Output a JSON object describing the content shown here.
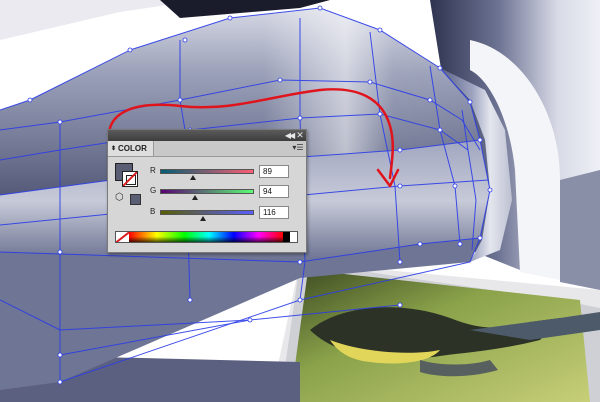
{
  "colors": {
    "fill": "#595e74",
    "accent_arrow": "#e0141c",
    "mesh": "#2b3de8",
    "panel_bg": "#d6d6d6",
    "titlebar": "#4a4a4a"
  },
  "icons": {
    "collapse": "double-chevron-left-icon",
    "close": "close-icon",
    "panel_menu": "panel-menu-icon",
    "tab_arrows": "updown-arrows-icon",
    "cube": "out-of-gamut-cube-icon"
  },
  "color_panel": {
    "collapse_glyph": "◀◀",
    "close_glyph": "✕",
    "tab_arrows_glyph": "⬍",
    "tab_label": "COLOR",
    "menu_glyph": "▾☰",
    "cube_glyph": "⬡",
    "channels": [
      {
        "label": "R",
        "value": "89",
        "fraction": 0.349
      },
      {
        "label": "G",
        "value": "94",
        "fraction": 0.369
      },
      {
        "label": "B",
        "value": "116",
        "fraction": 0.455
      }
    ]
  }
}
